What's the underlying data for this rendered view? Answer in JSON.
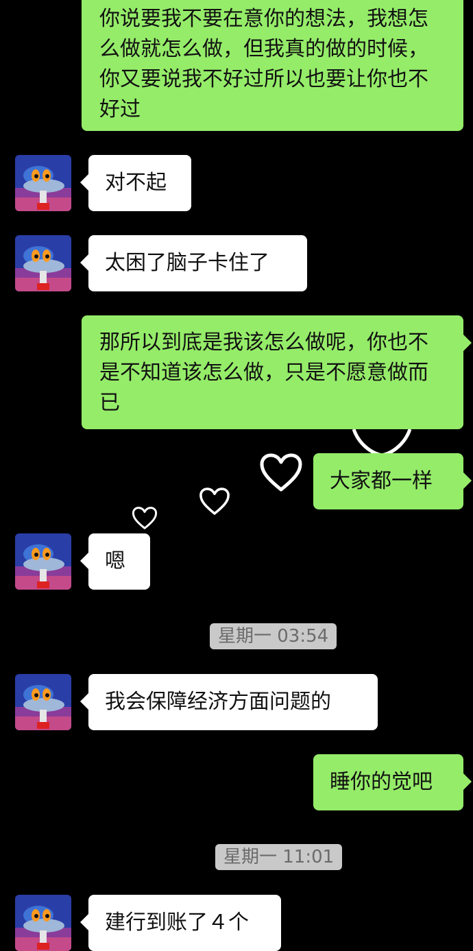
{
  "messages": [
    {
      "side": "sent",
      "text": "你说要我不要在意你的想法，我想怎么做就怎么做，但我真的做的时候，你又要说我不好过所以也要让你也不好过"
    },
    {
      "side": "received",
      "text": "对不起"
    },
    {
      "side": "received",
      "text": "太困了脑子卡住了"
    },
    {
      "side": "sent",
      "text": "那所以到底是我该怎么做呢，你也不是不知道该怎么做，只是不愿意做而已"
    },
    {
      "side": "sent",
      "text": "大家都一样"
    },
    {
      "side": "received",
      "text": "嗯"
    },
    {
      "side": "received",
      "text": "我会保障经济方面问题的"
    },
    {
      "side": "sent",
      "text": "睡你的觉吧"
    },
    {
      "side": "received",
      "text": "建行到账了４个"
    }
  ],
  "timestamps": [
    "星期一 03:54",
    "星期一 11:01"
  ],
  "colors": {
    "background": "#000000",
    "sent_bubble": "#95ec69",
    "received_bubble": "#ffffff",
    "timestamp_bg": "#c9c9c9"
  },
  "icons": {
    "avatar": "cartoon-character-avatar",
    "hearts": "heart-outline-icon"
  }
}
